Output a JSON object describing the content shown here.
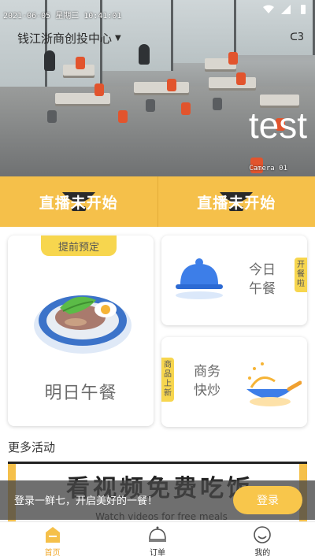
{
  "status_bar": {
    "timestamp": "2021-06-05 星期三 10:41:01"
  },
  "header": {
    "location": "钱江浙商创投中心",
    "location_chevron": "chevron-down-icon"
  },
  "camera": {
    "overlay_label": "test",
    "caption": "Camera 01"
  },
  "live_buttons": [
    {
      "label": "直播未开始",
      "icon": "bowl-icon"
    },
    {
      "label": "直播未开始",
      "icon": "bowl-icon"
    }
  ],
  "cards": {
    "tomorrow": {
      "badge": "提前预定",
      "title": "明日午餐",
      "icon": "meal-plate-icon"
    },
    "today": {
      "title_line1": "今日",
      "title_line2": "午餐",
      "tag": "开餐啦",
      "icon": "cloche-icon"
    },
    "stirfry": {
      "title_line1": "商务",
      "title_line2": "快炒",
      "tag": "商品上新",
      "icon": "wok-icon"
    }
  },
  "more_activities": {
    "title": "更多活动",
    "banner_title": "看视频免费吃饭",
    "banner_sub": "Watch videos for free meals"
  },
  "login_bar": {
    "text": "登录一鲜七，开启美好的一餐！",
    "button": "登录"
  },
  "tabs": [
    {
      "label": "首页",
      "icon": "home-icon",
      "active": true
    },
    {
      "label": "订单",
      "icon": "order-icon",
      "active": false
    },
    {
      "label": "我的",
      "icon": "profile-icon",
      "active": false
    }
  ],
  "colors": {
    "accent": "#f5c04a",
    "badge": "#f7d64e",
    "active_tab": "#f0a92e"
  }
}
